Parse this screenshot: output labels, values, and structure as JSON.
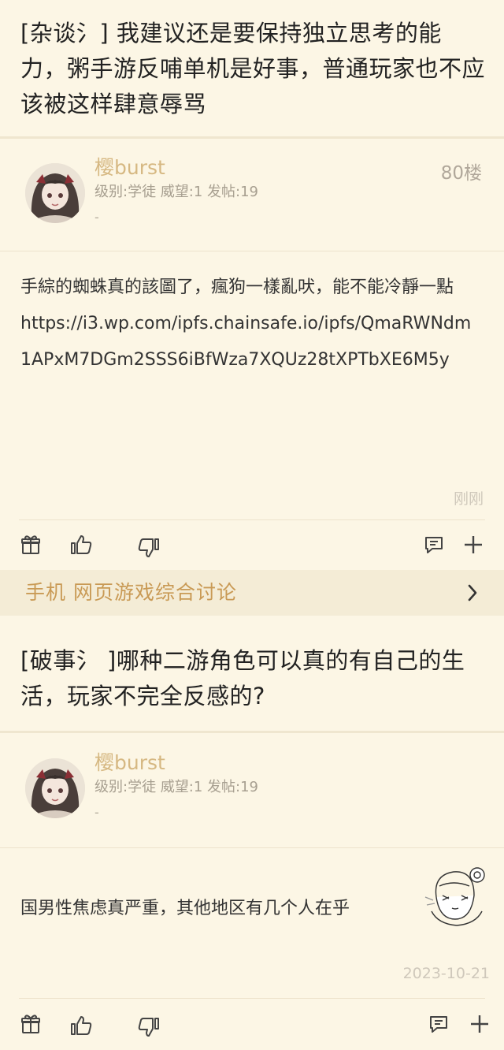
{
  "post1": {
    "thread_title": "[杂谈氵] 我建议还是要保持独立思考的能力，粥手游反哺单机是好事，普通玩家也不应该被这样肆意辱骂",
    "username": "樱burst",
    "user_info": "级别:学徒  威望:1  发帖:19",
    "dash": "-",
    "floor": "80楼",
    "content_line1": "手綜的蜘蛛真的該圖了，瘋狗一樣亂吠，能不能冷靜一點",
    "content_link": "https://i3.wp.com/ipfs.chainsafe.io/ipfs/QmaRWNdm1APxM7DGm2SSS6iBfWza7XQUz28tXPTbXE6M5y",
    "time": "刚刚"
  },
  "forum": {
    "name": "手机 网页游戏综合讨论"
  },
  "post2": {
    "thread_title": "[破事氵 ]哪种二游角色可以真的有自己的生活，玩家不完全反感的?",
    "username": "樱burst",
    "user_info": "级别:学徒  威望:1  发帖:19",
    "dash": "-",
    "content": "国男性焦虑真严重，其他地区有几个人在乎",
    "time": "2023-10-21"
  },
  "icons": {
    "gift": "gift-icon",
    "like": "thumbs-up-icon",
    "dislike": "thumbs-down-icon",
    "comment": "comment-icon",
    "more": "plus-icon",
    "chevron": "chevron-right-icon"
  },
  "colors": {
    "background": "#fcf6e5",
    "username": "#d6b882",
    "forum_name": "#c99a55",
    "forum_bar": "#f4ecd6"
  }
}
